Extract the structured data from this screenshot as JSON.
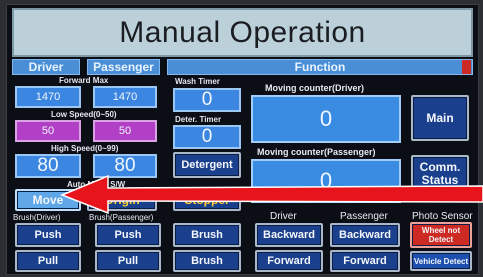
{
  "title": "Manual Operation",
  "headers": {
    "driver": "Driver",
    "passenger": "Passenger",
    "function": "Function"
  },
  "speeds": {
    "forward_max_label": "Forward Max",
    "forward_max_driver": "1470",
    "forward_max_passenger": "1470",
    "low_speed_label": "Low Speed(0~50)",
    "low_speed_driver": "50",
    "low_speed_passenger": "50",
    "high_speed_label": "High Speed(0~99)",
    "high_speed_driver": "80",
    "high_speed_passenger": "80",
    "auto_move_label": "Auto Move S/W"
  },
  "timers": {
    "wash_label": "Wash Timer",
    "wash_value": "0",
    "deter_label": "Deter. Timer",
    "deter_value": "0"
  },
  "counters": {
    "driver_label": "Moving counter(Driver)",
    "driver_value": "0",
    "passenger_label": "Moving counter(Passenger)",
    "passenger_value": "0"
  },
  "buttons": {
    "main": "Main",
    "comm_status": "Comm. Status",
    "detergent": "Detergent",
    "move": "Move",
    "origin": "Origin",
    "stopper": "Stopper"
  },
  "bottom": {
    "brush_driver_label": "Brush(Driver)",
    "brush_passenger_label": "Brush(Passenger)",
    "driver_label": "Driver",
    "passenger_label": "Passenger",
    "photo_sensor_label": "Photo Sensor",
    "push_driver": "Push",
    "push_passenger": "Push",
    "pull_driver": "Pull",
    "pull_passenger": "Pull",
    "brush_1": "Brush",
    "brush_2": "Brush",
    "backward_driver": "Backward",
    "backward_passenger": "Backward",
    "forward_driver": "Forward",
    "forward_passenger": "Forward",
    "wheel_not_detect": "Wheel not Detect",
    "vehicle_detect": "Vehicle Detect"
  },
  "colors": {
    "annotation_arrow": "#e8141c",
    "highlight_button": "#5fa7e6",
    "alert_red": "#cc2a22"
  }
}
